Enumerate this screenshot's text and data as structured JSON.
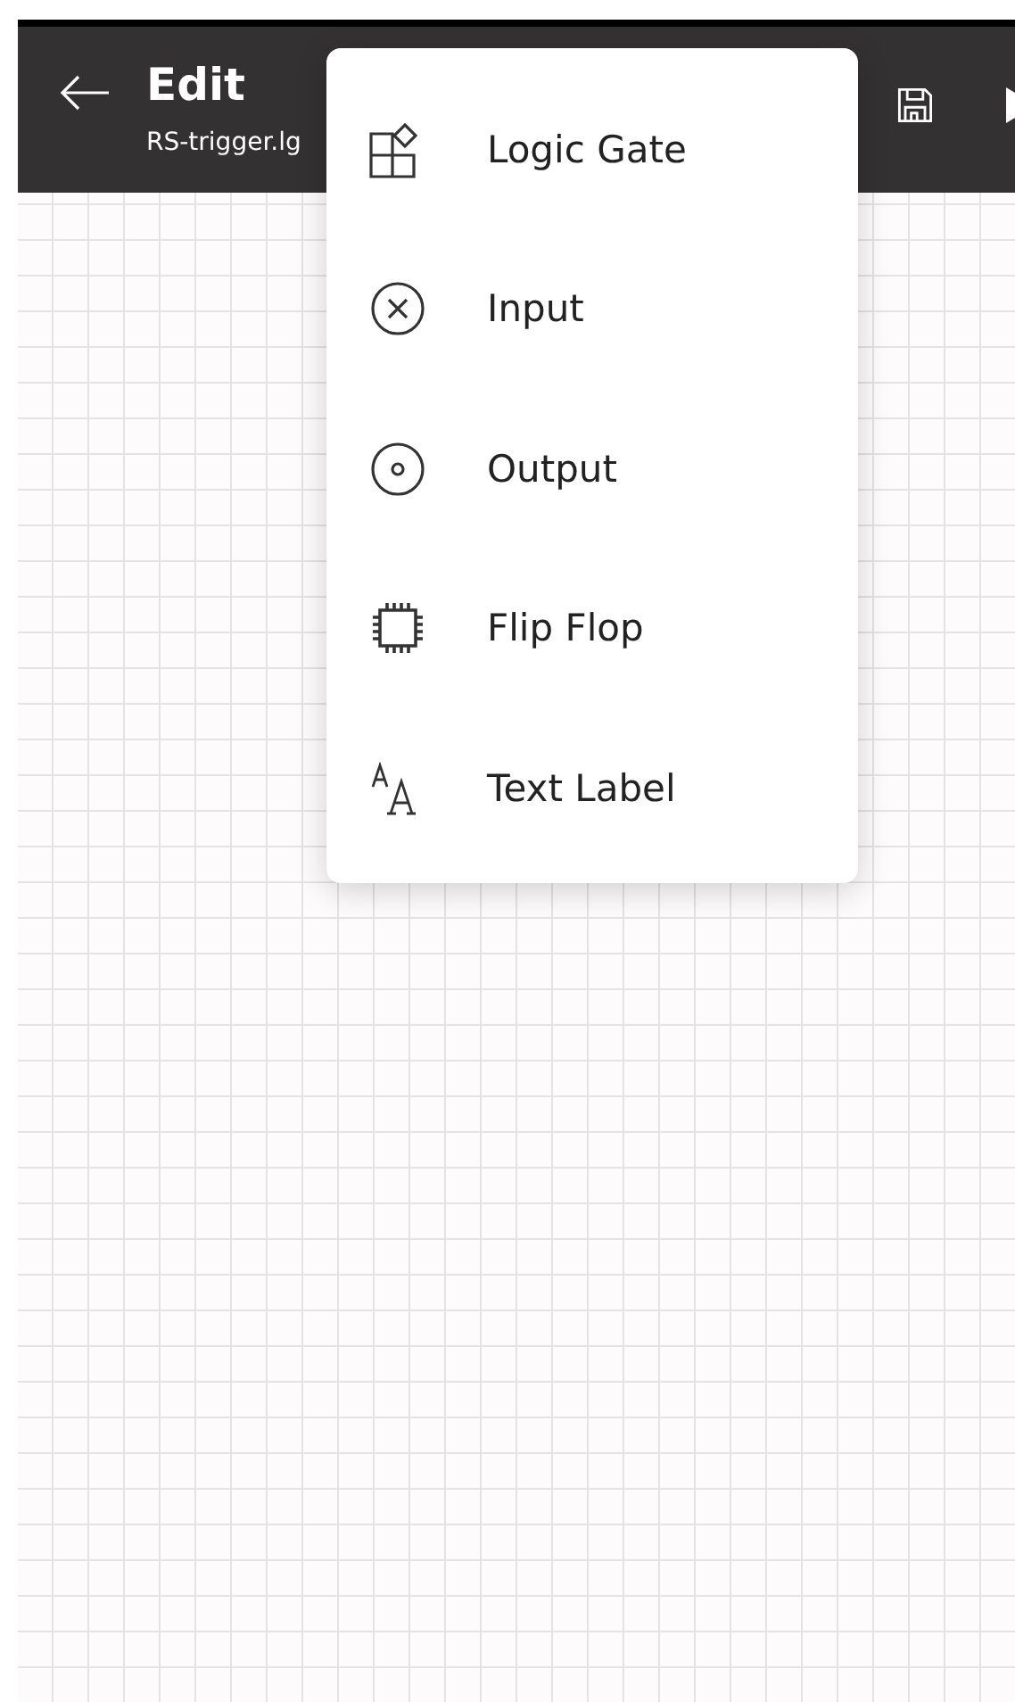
{
  "header": {
    "title": "Edit",
    "subtitle": "RS-trigger.lg"
  },
  "menu": {
    "items": [
      {
        "kind": "gate",
        "label": "Logic Gate"
      },
      {
        "kind": "input",
        "label": "Input"
      },
      {
        "kind": "output",
        "label": "Output"
      },
      {
        "kind": "flipflop",
        "label": "Flip Flop"
      },
      {
        "kind": "text",
        "label": "Text Label"
      }
    ]
  }
}
